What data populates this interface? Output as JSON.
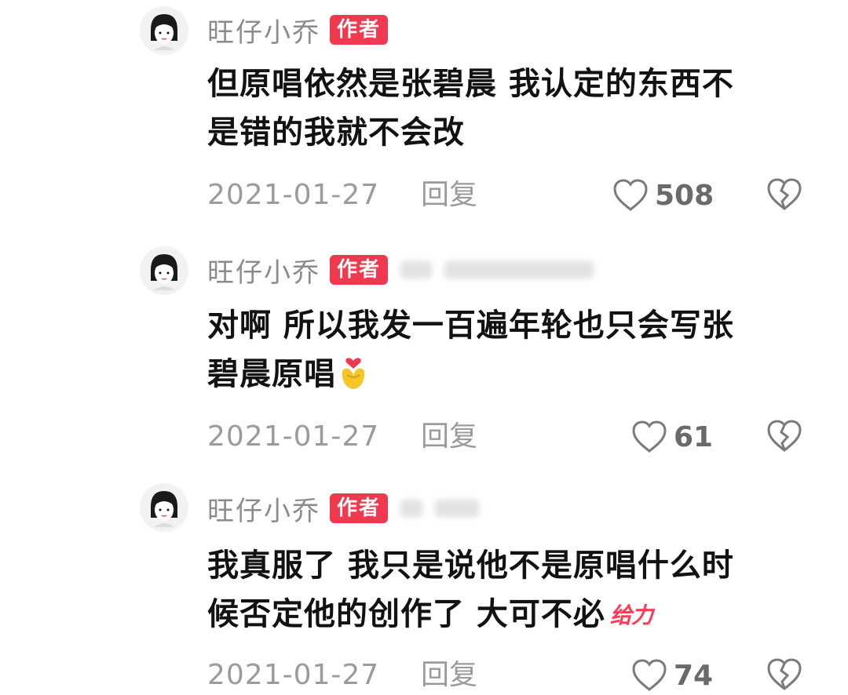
{
  "comments": [
    {
      "username": "旺仔小乔",
      "badge": "作者",
      "text": "但原唱依然是张碧晨 我认定的东西不\n是错的我就不会改",
      "date": "2021-01-27",
      "reply_label": "回复",
      "likes": "508",
      "reply_target_hidden": false
    },
    {
      "username": "旺仔小乔",
      "badge": "作者",
      "text": "对啊 所以我发一百遍年轮也只会写张\n碧晨原唱",
      "emoji": "heart-hands-emoji",
      "date": "2021-01-27",
      "reply_label": "回复",
      "likes": "61",
      "reply_target_hidden": true
    },
    {
      "username": "旺仔小乔",
      "badge": "作者",
      "text": "我真服了 我只是说他不是原唱什么时\n候否定他的创作了 大可不必",
      "sticker": "给力",
      "date": "2021-01-27",
      "reply_label": "回复",
      "likes": "74",
      "reply_target_hidden": true
    }
  ],
  "colors": {
    "badge": "#f0384f",
    "meta_text": "#9b9b9b",
    "username": "#8b8b8b"
  },
  "icons": [
    "avatar",
    "heart-outline-icon",
    "broken-heart-icon"
  ]
}
